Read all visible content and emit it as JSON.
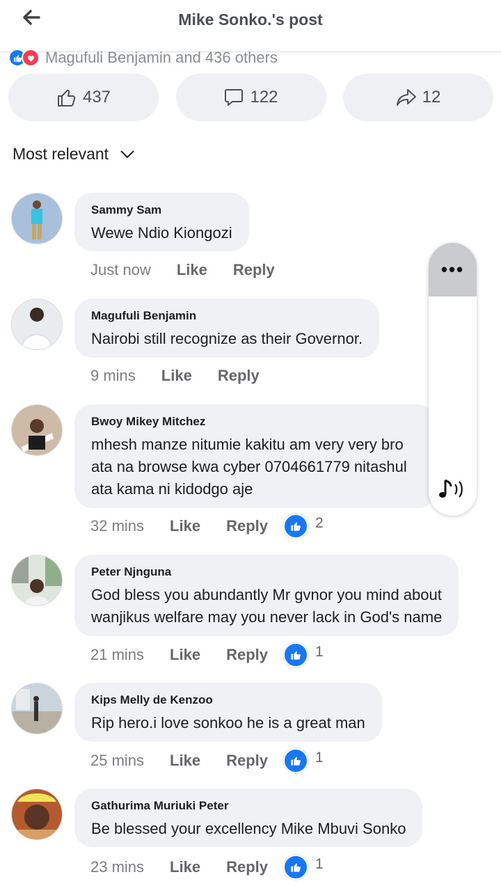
{
  "header": {
    "title": "Mike Sonko.'s post",
    "back_icon": "arrow-left-icon"
  },
  "reactions_summary": {
    "text": "Magufuli Benjamin and 436 others"
  },
  "actions": {
    "like_count": "437",
    "comment_count": "122",
    "share_count": "12"
  },
  "sort": {
    "label": "Most relevant"
  },
  "comments": [
    {
      "author": "Sammy Sam",
      "text": [
        "Wewe Ndio Kiongozi"
      ],
      "time": "Just now",
      "like": "Like",
      "reply": "Reply",
      "reactions": ""
    },
    {
      "author": "Magufuli Benjamin",
      "text": [
        "Nairobi still recognize as their Governor."
      ],
      "time": "9 mins",
      "like": "Like",
      "reply": "Reply",
      "reactions": ""
    },
    {
      "author": "Bwoy Mikey Mitchez",
      "text": [
        "mhesh manze nitumie kakitu am very very bro",
        "ata na browse kwa cyber 0704661779 nitashul",
        "ata kama ni kidodgo aje"
      ],
      "time": "32 mins",
      "like": "Like",
      "reply": "Reply",
      "reactions": "2"
    },
    {
      "author": "Peter Njnguna",
      "text": [
        "God bless you abundantly Mr gvnor you mind about",
        "wanjikus welfare may you never lack in God's name"
      ],
      "time": "21 mins",
      "like": "Like",
      "reply": "Reply",
      "reactions": "1"
    },
    {
      "author": "Kips Melly de Kenzoo",
      "text": [
        "Rip hero.i love sonkoo he is a great man"
      ],
      "time": "25 mins",
      "like": "Like",
      "reply": "Reply",
      "reactions": "1"
    },
    {
      "author": "Gathurima Muriuki Peter",
      "text": [
        "Be blessed your excellency Mike Mbuvi Sonko"
      ],
      "time": "23 mins",
      "like": "Like",
      "reply": "Reply",
      "reactions": "1"
    }
  ],
  "floating_panel": {
    "more_label": "•••",
    "audio_icon": "music-note-sound-icon"
  },
  "colors": {
    "accent": "#1877f2",
    "bubble": "#eff1f4",
    "love": "#f33e58"
  }
}
